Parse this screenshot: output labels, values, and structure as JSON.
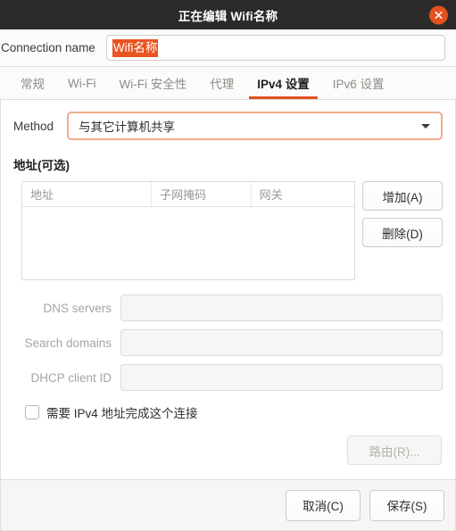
{
  "titlebar": {
    "title": "正在编辑 Wifi名称",
    "close_icon": "close-icon",
    "close_glyph": "×",
    "background": "#2c2b29",
    "close_color": "#e2511f"
  },
  "connection": {
    "label": "Connection name",
    "value": "Wifi名称",
    "selection_color": "#e95420",
    "selected": true
  },
  "tabs": [
    {
      "label": "常规",
      "active": false
    },
    {
      "label": "Wi-Fi",
      "active": false
    },
    {
      "label": "Wi-Fi 安全性",
      "active": false
    },
    {
      "label": "代理",
      "active": false
    },
    {
      "label": "IPv4 设置",
      "active": true
    },
    {
      "label": "IPv6 设置",
      "active": false
    }
  ],
  "accent_color": "#e2511f",
  "method": {
    "label": "Method",
    "value": "与其它计算机共享",
    "caret_icon": "chevron-down-icon",
    "focused": true,
    "focus_border_color": "#f0ab8e"
  },
  "addresses": {
    "section_title": "地址(可选)",
    "columns": [
      "地址",
      "子网掩码",
      "网关"
    ],
    "rows": [],
    "add_button": "增加(A)",
    "delete_button": "删除(D)"
  },
  "fields": [
    {
      "label": "DNS servers",
      "value": "",
      "disabled": true
    },
    {
      "label": "Search domains",
      "value": "",
      "disabled": true
    },
    {
      "label": "DHCP client ID",
      "value": "",
      "disabled": true
    }
  ],
  "require_ipv4": {
    "label": "需要 IPv4 地址完成这个连接",
    "checked": false
  },
  "routes_button": {
    "label": "路由(R)...",
    "disabled": true
  },
  "footer": {
    "cancel": "取消(C)",
    "save": "保存(S)"
  }
}
